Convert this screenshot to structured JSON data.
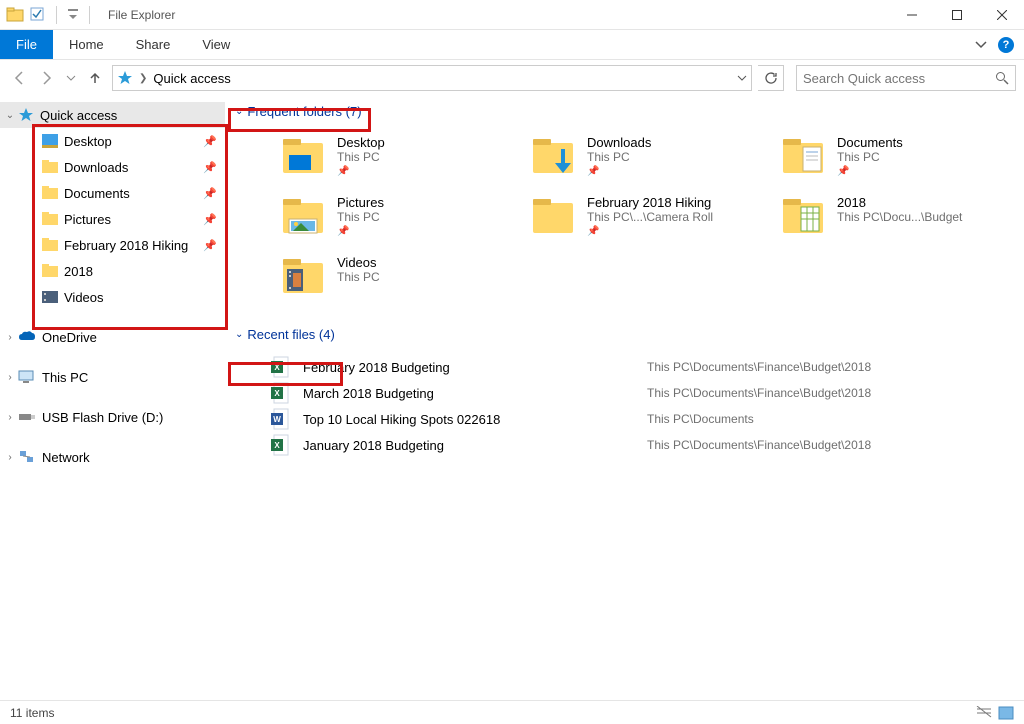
{
  "window": {
    "title": "File Explorer"
  },
  "ribbon": {
    "file": "File",
    "home": "Home",
    "share": "Share",
    "view": "View"
  },
  "breadcrumb": {
    "root": "Quick access"
  },
  "search": {
    "placeholder": "Search Quick access"
  },
  "sidebar": {
    "quick_access": "Quick access",
    "items": [
      {
        "label": "Desktop"
      },
      {
        "label": "Downloads"
      },
      {
        "label": "Documents"
      },
      {
        "label": "Pictures"
      },
      {
        "label": "February 2018 Hiking"
      },
      {
        "label": "2018"
      },
      {
        "label": "Videos"
      }
    ],
    "onedrive": "OneDrive",
    "this_pc": "This PC",
    "usb": "USB Flash Drive (D:)",
    "network": "Network"
  },
  "groups": {
    "frequent": {
      "label": "Frequent folders (7)"
    },
    "recent": {
      "label": "Recent files (4)"
    }
  },
  "frequent_folders": [
    {
      "name": "Desktop",
      "sub": "This PC",
      "pinned": true,
      "type": "desktop"
    },
    {
      "name": "Downloads",
      "sub": "This PC",
      "pinned": true,
      "type": "downloads"
    },
    {
      "name": "Documents",
      "sub": "This PC",
      "pinned": true,
      "type": "documents"
    },
    {
      "name": "Pictures",
      "sub": "This PC",
      "pinned": true,
      "type": "pictures"
    },
    {
      "name": "February 2018 Hiking",
      "sub": "This PC\\...\\Camera Roll",
      "pinned": true,
      "type": "folder"
    },
    {
      "name": "2018",
      "sub": "This PC\\Docu...\\Budget",
      "pinned": false,
      "type": "folder-sheets"
    },
    {
      "name": "Videos",
      "sub": "This PC",
      "pinned": false,
      "type": "videos"
    }
  ],
  "recent_files": [
    {
      "name": "February 2018 Budgeting",
      "path": "This PC\\Documents\\Finance\\Budget\\2018",
      "type": "excel"
    },
    {
      "name": "March 2018 Budgeting",
      "path": "This PC\\Documents\\Finance\\Budget\\2018",
      "type": "excel"
    },
    {
      "name": "Top 10 Local Hiking Spots 022618",
      "path": "This PC\\Documents",
      "type": "word"
    },
    {
      "name": "January 2018 Budgeting",
      "path": "This PC\\Documents\\Finance\\Budget\\2018",
      "type": "excel"
    }
  ],
  "status": {
    "items": "11 items"
  }
}
